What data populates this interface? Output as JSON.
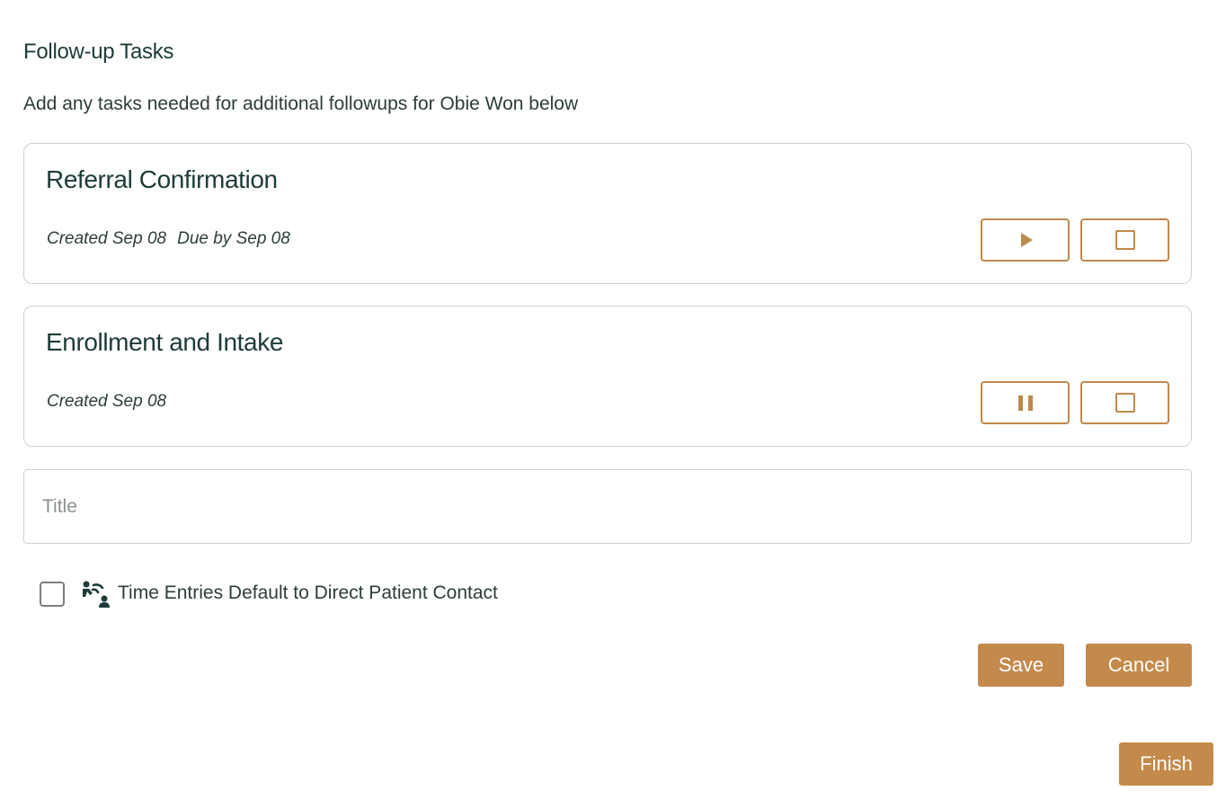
{
  "section": {
    "title": "Follow-up Tasks",
    "subtitle": "Add any tasks needed for additional followups for Obie Won below"
  },
  "tasks": [
    {
      "title": "Referral Confirmation",
      "created": "Created Sep 08",
      "due": "Due by Sep 08",
      "timer_state_icon": "play-icon",
      "complete_icon": "square-icon"
    },
    {
      "title": "Enrollment and Intake",
      "created": "Created Sep 08",
      "due": "",
      "timer_state_icon": "pause-icon",
      "complete_icon": "square-icon"
    }
  ],
  "new_task": {
    "title_placeholder": "Title",
    "title_value": ""
  },
  "direct_contact": {
    "checked": false,
    "icon": "person-contact-icon",
    "label": "Time Entries Default to Direct Patient Contact"
  },
  "actions": {
    "save_label": "Save",
    "cancel_label": "Cancel",
    "finish_label": "Finish"
  },
  "colors": {
    "accent": "#c48a4c",
    "heading": "#1d3b38",
    "border": "#cfd3d4"
  }
}
